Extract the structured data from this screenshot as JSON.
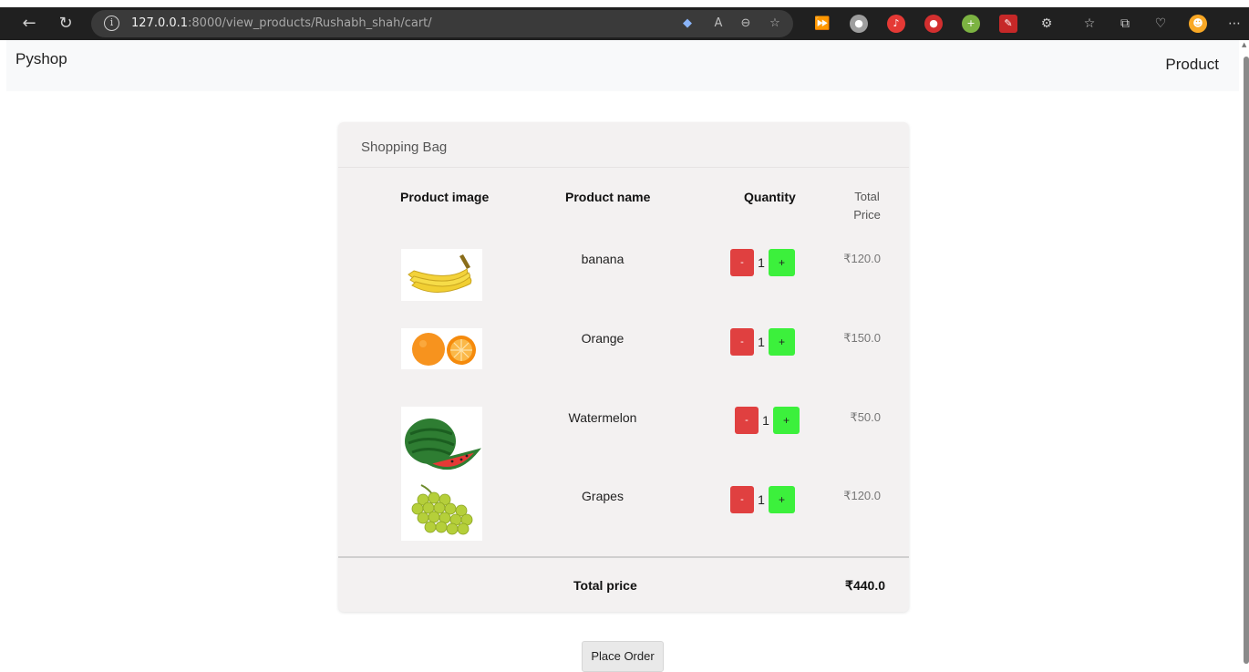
{
  "browser": {
    "url_host": "127.0.0.1",
    "url_rest": ":8000/view_products/Rushabh_shah/cart/",
    "back_icon": "back-arrow-icon",
    "refresh_icon": "refresh-icon"
  },
  "site": {
    "brand": "Pyshop",
    "nav_link": "Product"
  },
  "cart": {
    "title": "Shopping Bag",
    "headers": {
      "image": "Product image",
      "name": "Product name",
      "quantity": "Quantity",
      "total_price": "Total Price"
    },
    "items": [
      {
        "name": "banana",
        "quantity": "1",
        "price": "₹120.0",
        "image": "banana-image",
        "minus": "-",
        "plus": "+"
      },
      {
        "name": "Orange",
        "quantity": "1",
        "price": "₹150.0",
        "image": "orange-image",
        "minus": "-",
        "plus": "+"
      },
      {
        "name": "Watermelon",
        "quantity": "1",
        "price": "₹50.0",
        "image": "watermelon-image",
        "minus": "-",
        "plus": "+"
      },
      {
        "name": "Grapes",
        "quantity": "1",
        "price": "₹120.0",
        "image": "grapes-image",
        "minus": "-",
        "plus": "+"
      }
    ],
    "total_label": "Total price",
    "total_value": "₹440.0",
    "place_order": "Place Order"
  },
  "colors": {
    "minus_button": "#e04040",
    "plus_button": "#3cf03c",
    "card_bg": "#f3f1f1"
  }
}
